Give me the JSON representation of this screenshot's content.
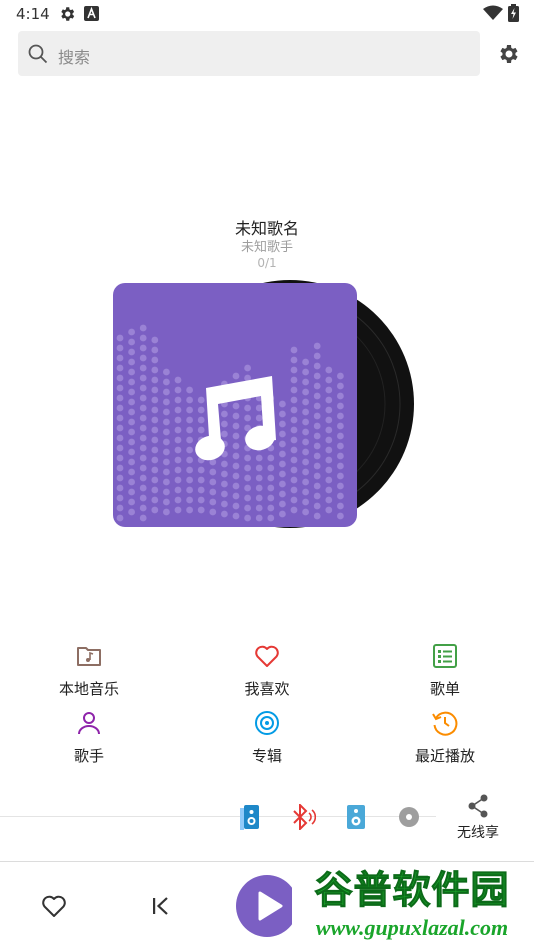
{
  "status_bar": {
    "time": "4:14",
    "icons": [
      "gear-icon",
      "a-icon",
      "wifi-icon",
      "battery-icon"
    ]
  },
  "search": {
    "placeholder": "搜索",
    "icon": "search-icon",
    "settings_icon": "gear-icon"
  },
  "now_playing": {
    "title": "未知歌名",
    "artist": "未知歌手",
    "position": "0/1",
    "cover_color": "#7b5fc3"
  },
  "shortcuts": [
    {
      "label": "本地音乐",
      "icon": "folder-music-icon",
      "color": "#8d6e63"
    },
    {
      "label": "我喜欢",
      "icon": "heart-icon",
      "color": "#e53935"
    },
    {
      "label": "歌单",
      "icon": "playlist-icon",
      "color": "#43a047"
    },
    {
      "label": "歌手",
      "icon": "person-icon",
      "color": "#8e24aa"
    },
    {
      "label": "专辑",
      "icon": "album-icon",
      "color": "#039be5"
    },
    {
      "label": "最近播放",
      "icon": "history-icon",
      "color": "#fb8c00"
    }
  ],
  "devices": {
    "icons": [
      "speaker-icon",
      "bluetooth-audio-icon",
      "speaker-icon",
      "disc-icon"
    ],
    "wireless_label": "无线享",
    "wireless_icon": "share-icon"
  },
  "player_bar": {
    "icons": [
      "heart-icon",
      "skip-previous-icon",
      "play-icon"
    ],
    "accent": "#7b5fc3"
  },
  "watermark": {
    "title": "谷普软件园",
    "url": "www.gupuxlazal.com"
  }
}
